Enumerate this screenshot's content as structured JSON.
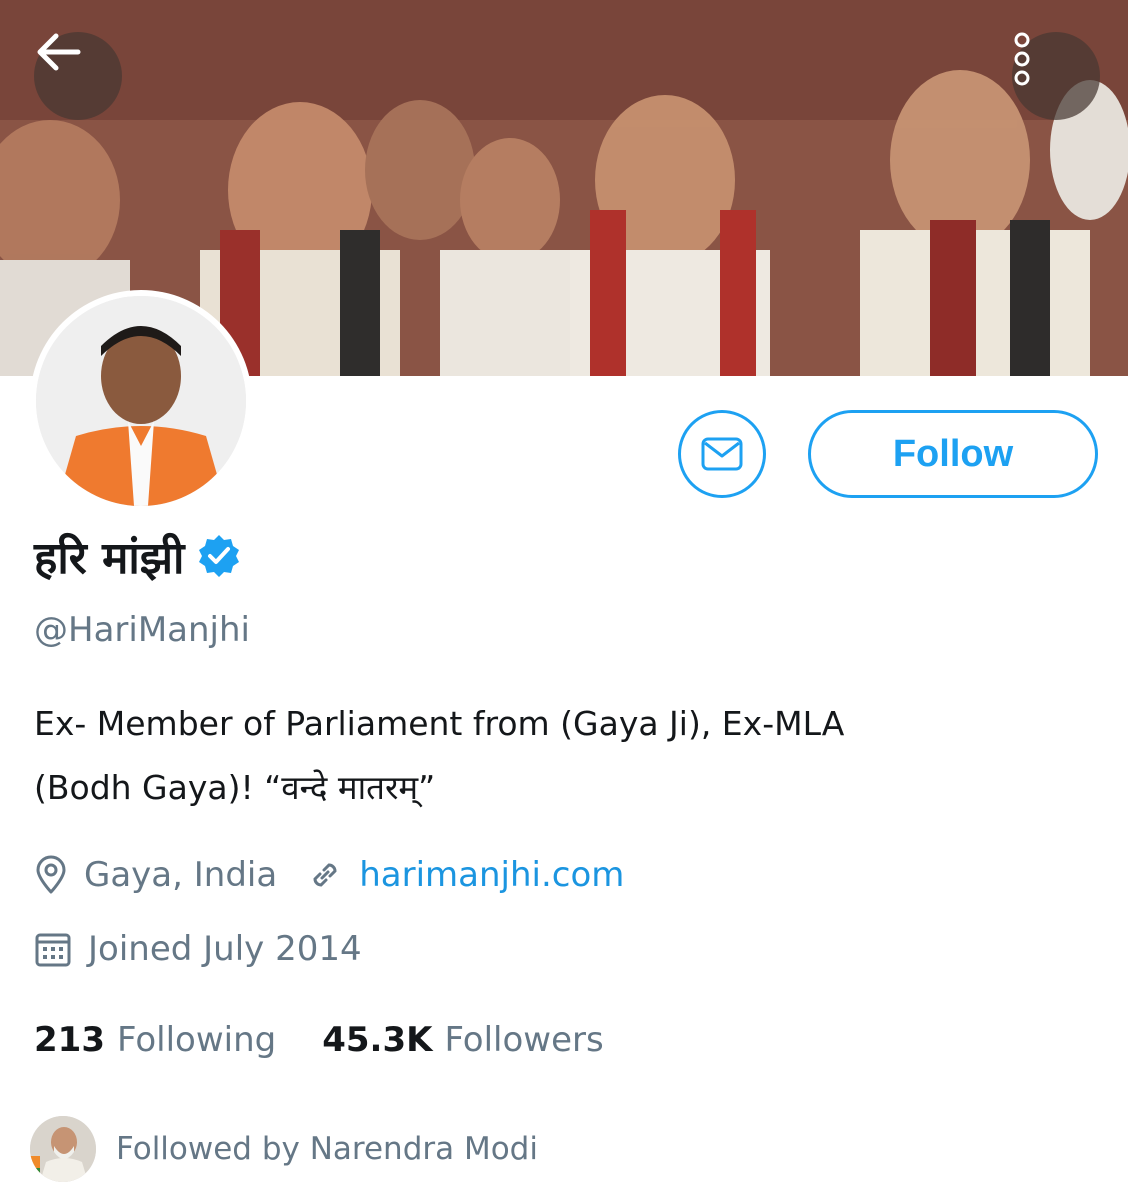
{
  "profile": {
    "display_name": "हरि मांझी",
    "handle": "@HariManjhi",
    "bio_line1": "Ex- Member of Parliament from (Gaya Ji), Ex-MLA",
    "bio_line2": "(Bodh Gaya)! “वन्दे मातरम्”",
    "location": "Gaya, India",
    "website": "harimanjhi.com",
    "joined": "Joined July 2014",
    "verified": true
  },
  "stats": {
    "following_count": "213",
    "following_label": "Following",
    "followers_count": "45.3K",
    "followers_label": "Followers"
  },
  "followed_by": {
    "text": "Followed by Narendra Modi"
  },
  "actions": {
    "follow_label": "Follow"
  },
  "icons": {
    "back": "back-arrow-icon",
    "more": "more-vertical-icon",
    "message": "envelope-icon",
    "verified": "verified-badge-icon",
    "location": "location-pin-icon",
    "link": "link-icon",
    "calendar": "calendar-icon"
  },
  "colors": {
    "accent": "#1da1f2",
    "link": "#1b95e0",
    "secondary_text": "#657786",
    "primary_text": "#14171a"
  }
}
